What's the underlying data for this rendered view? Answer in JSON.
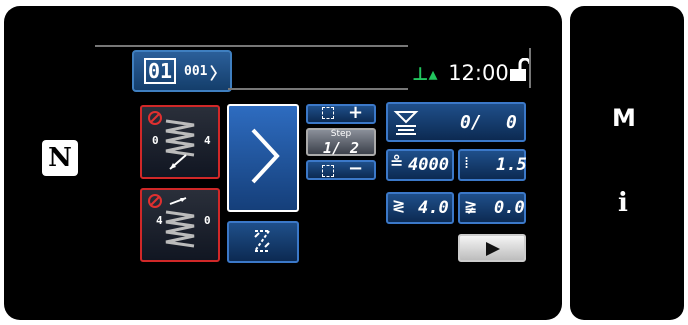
{
  "pattern": {
    "main": "01",
    "sub": "001"
  },
  "status": {
    "time": "12:00"
  },
  "step": {
    "label": "Step",
    "value": "1/ 2",
    "add": "+",
    "remove": "−"
  },
  "counter": {
    "current": "0/",
    "total": "0"
  },
  "speed": {
    "value": "4000"
  },
  "stitch": {
    "pitch": "1.5",
    "width": "4.0",
    "offset": "0.0"
  },
  "side": {
    "mode": "M",
    "info": "i"
  },
  "tacking": {
    "start_values": [
      "0",
      "4"
    ],
    "end_values": [
      "4",
      "0"
    ]
  }
}
